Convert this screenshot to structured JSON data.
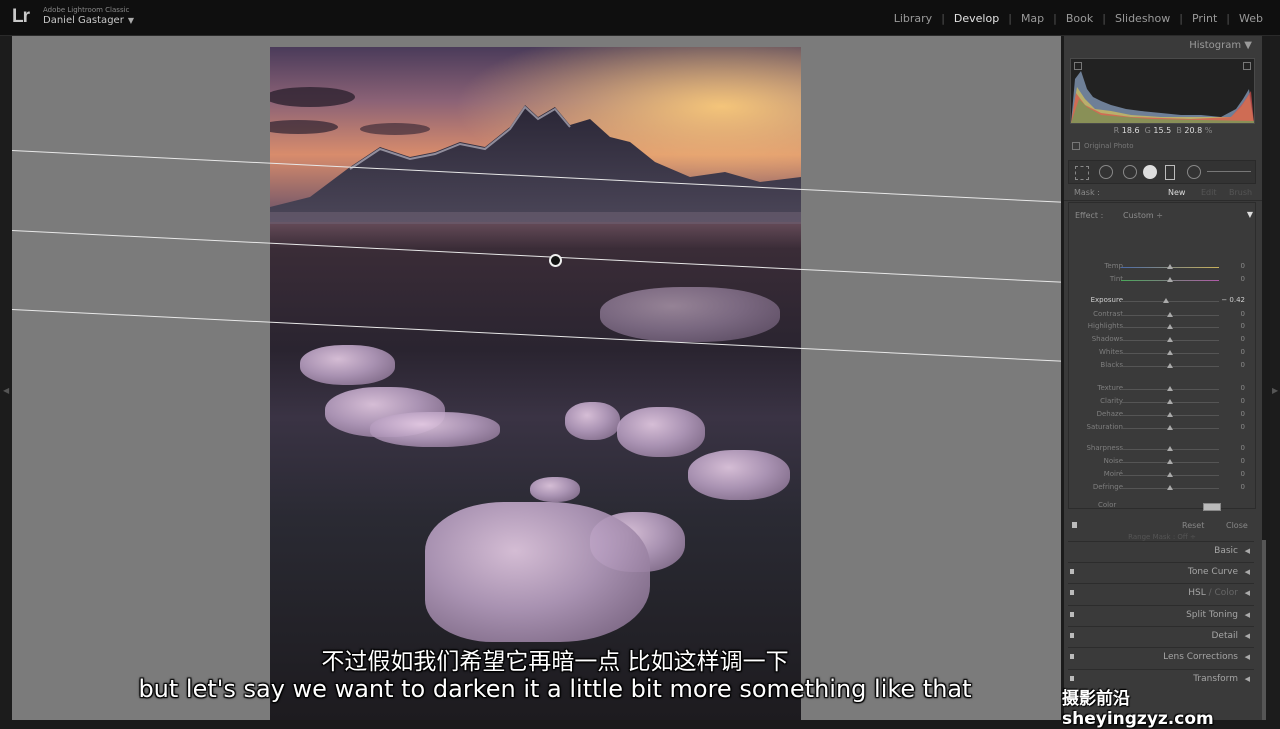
{
  "app": {
    "name": "Adobe Lightroom Classic",
    "logo": "Lr",
    "user": "Daniel Gastager"
  },
  "modules": [
    "Library",
    "Develop",
    "Map",
    "Book",
    "Slideshow",
    "Print",
    "Web"
  ],
  "active_module": "Develop",
  "histogram": {
    "title": "Histogram",
    "r_label": "R",
    "r_value": "18.6",
    "g_label": "G",
    "g_value": "15.5",
    "b_label": "B",
    "b_value": "20.8",
    "unit": "%",
    "original_photo": "Original Photo"
  },
  "mask": {
    "label": "Mask :",
    "new": "New",
    "edit": "Edit",
    "brush": "Brush"
  },
  "effect": {
    "label": "Effect :",
    "preset": "Custom ÷"
  },
  "sliders": [
    {
      "label": "Temp",
      "value": "0"
    },
    {
      "label": "Tint",
      "value": "0"
    },
    {
      "label": "Exposure",
      "value": "− 0.42"
    },
    {
      "label": "Contrast",
      "value": "0"
    },
    {
      "label": "Highlights",
      "value": "0"
    },
    {
      "label": "Shadows",
      "value": "0"
    },
    {
      "label": "Whites",
      "value": "0"
    },
    {
      "label": "Blacks",
      "value": "0"
    },
    {
      "label": "Texture",
      "value": "0"
    },
    {
      "label": "Clarity",
      "value": "0"
    },
    {
      "label": "Dehaze",
      "value": "0"
    },
    {
      "label": "Saturation",
      "value": "0"
    },
    {
      "label": "Sharpness",
      "value": "0"
    },
    {
      "label": "Noise",
      "value": "0"
    },
    {
      "label": "Moiré",
      "value": "0"
    },
    {
      "label": "Defringe",
      "value": "0"
    }
  ],
  "color_label": "Color",
  "range_mask": "Range Mask : Off ÷",
  "mask_footer": {
    "reset": "Reset",
    "close": "Close"
  },
  "sections": [
    "Basic",
    "Tone Curve",
    "Split Toning",
    "Detail",
    "Lens Corrections",
    "Transform"
  ],
  "hsl": {
    "hsl": "HSL",
    "sep": " / ",
    "color": "Color"
  },
  "subtitles": {
    "zh": "不过假如我们希望它再暗一点 比如这样调一下",
    "en": "but let's say we want to darken it a little bit more something like that"
  },
  "watermark": "摄影前沿 sheyingzyz.com",
  "colors": {
    "accent": "#e4e4e4",
    "panel": "#3a3a3a",
    "canvas": "#7b7b7b"
  }
}
